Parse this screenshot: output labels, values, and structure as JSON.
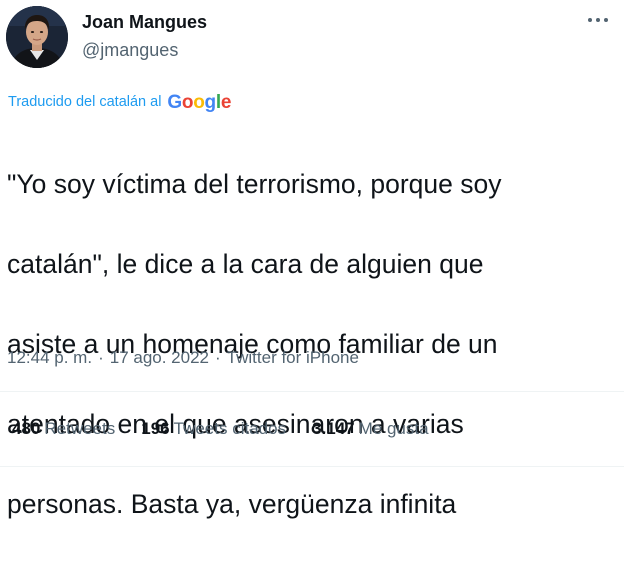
{
  "author": {
    "display_name": "Joan Mangues",
    "handle": "@jmangues",
    "avatar_icon": "profile-photo"
  },
  "translation": {
    "label": "Traducido del catalán al",
    "provider": "Google",
    "colors": {
      "blue": "#4285F4",
      "red": "#EA4335",
      "yellow": "#FBBC05",
      "green": "#34A853",
      "link": "#1d9bf0"
    }
  },
  "tweet": {
    "text_lines": [
      "\"Yo soy víctima del terrorismo, porque soy",
      "catalán\", le dice a la cara de alguien que",
      "asiste a un homenaje como familiar de un",
      "atentado en el que asesinaron a varias",
      "personas. Basta ya, vergüenza infinita"
    ],
    "time": "12:44 p. m.",
    "date": "17 ago. 2022",
    "separator": "·",
    "source": "Twitter for iPhone"
  },
  "stats": {
    "retweets": {
      "count": "480",
      "label": "Retweets"
    },
    "quotes": {
      "count": "196",
      "label": "Tweets citados"
    },
    "likes": {
      "count": "3.147",
      "label": "Me gusta"
    }
  },
  "menu": {
    "more_icon": "more-options-icon"
  }
}
